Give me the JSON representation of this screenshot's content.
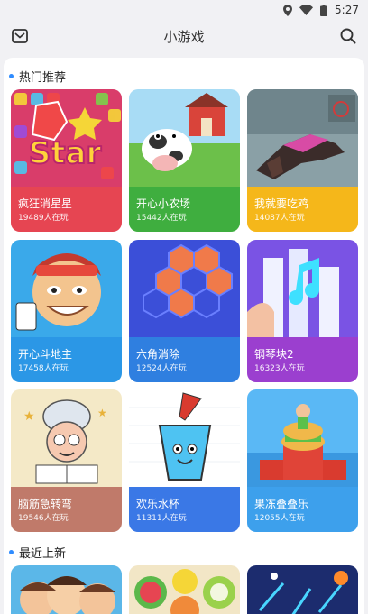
{
  "status_bar": {
    "time": "5:27",
    "icons": [
      "location-icon",
      "wifi-icon",
      "battery-icon"
    ]
  },
  "header": {
    "title": "小游戏",
    "left_icon": "mail-icon",
    "right_icon": "search-icon"
  },
  "sections": {
    "hot": {
      "title": "热门推荐",
      "accent": "#2f8cff"
    },
    "recent": {
      "title": "最近上新",
      "accent": "#2f8cff"
    }
  },
  "games": [
    {
      "name": "疯狂消星星",
      "players": "19489人在玩",
      "color": "#e64552"
    },
    {
      "name": "开心小农场",
      "players": "15442人在玩",
      "color": "#3fae3f"
    },
    {
      "name": "我就要吃鸡",
      "players": "14087人在玩",
      "color": "#f5b71a"
    },
    {
      "name": "开心斗地主",
      "players": "17458人在玩",
      "color": "#2b97e6"
    },
    {
      "name": "六角消除",
      "players": "12524人在玩",
      "color": "#2f7fe0"
    },
    {
      "name": "钢琴块2",
      "players": "16323人在玩",
      "color": "#9b3fcf"
    },
    {
      "name": "脑筋急转弯",
      "players": "19546人在玩",
      "color": "#c07a6a"
    },
    {
      "name": "欢乐水杯",
      "players": "11311人在玩",
      "color": "#3a78e6"
    },
    {
      "name": "果冻叠叠乐",
      "players": "12055人在玩",
      "color": "#3da0ec"
    }
  ]
}
